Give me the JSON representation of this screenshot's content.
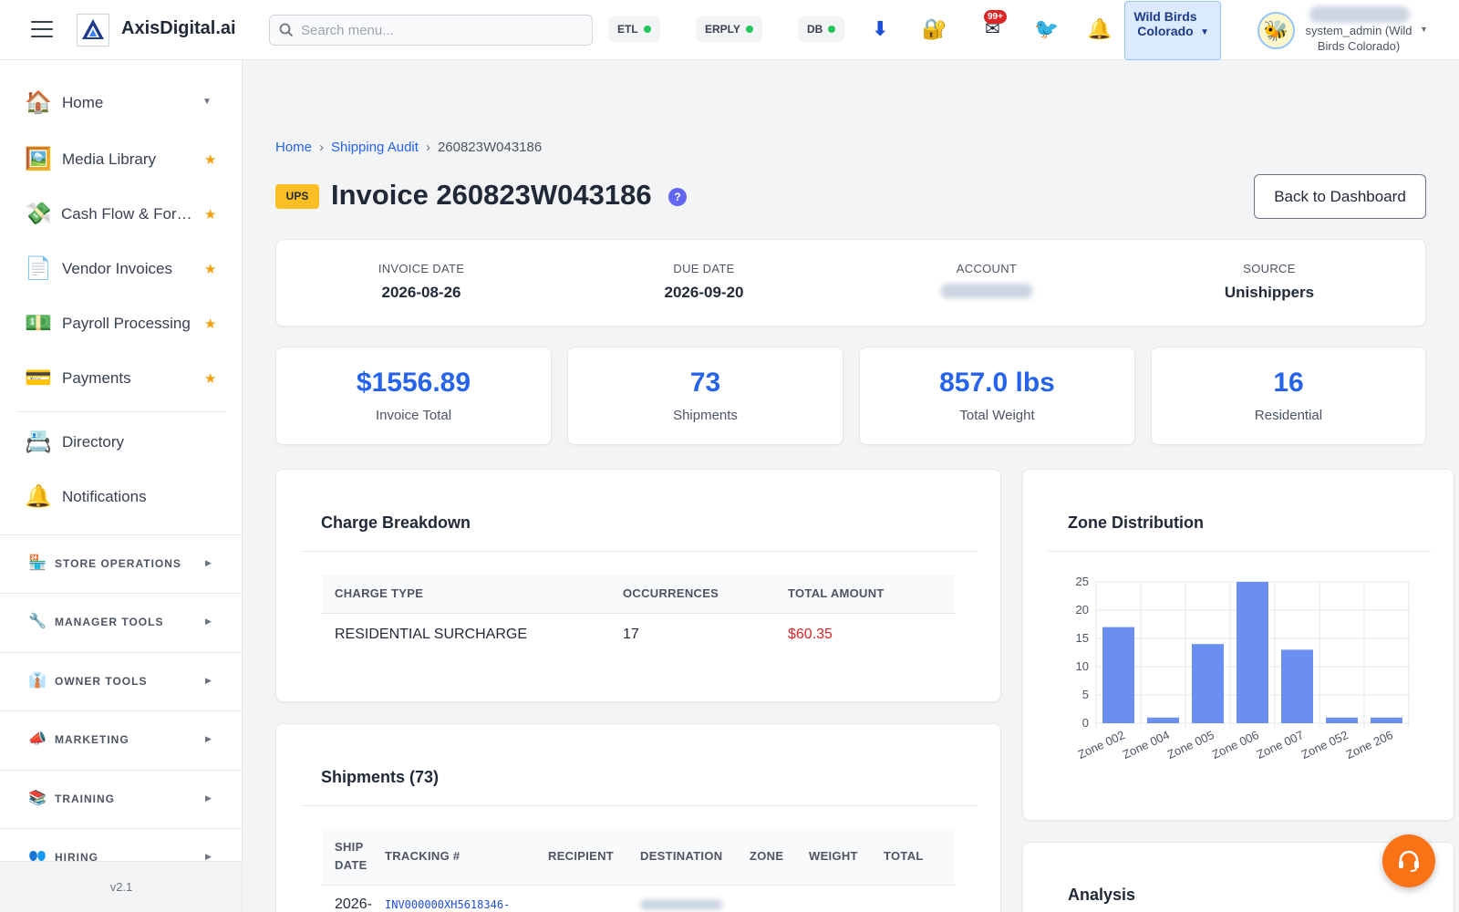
{
  "header": {
    "brand": "AxisDigital.ai",
    "search_placeholder": "Search menu...",
    "pills": [
      {
        "label": "ETL"
      },
      {
        "label": "ERPLY"
      },
      {
        "label": "DB"
      }
    ],
    "mail_badge": "99+",
    "store_label": "Wild Birds Colorado",
    "user_role": "system_admin (Wild Birds Colorado)"
  },
  "sidebar": {
    "items": [
      {
        "label": "Home",
        "icon": "house-icon"
      },
      {
        "label": "Media Library",
        "icon": "picture-icon"
      },
      {
        "label": "Cash Flow & Forecasting",
        "icon": "money-wings-icon"
      },
      {
        "label": "Vendor Invoices",
        "icon": "document-icon"
      },
      {
        "label": "Payroll Processing",
        "icon": "dollar-bill-icon"
      },
      {
        "label": "Payments",
        "icon": "credit-card-icon"
      },
      {
        "label": "Directory",
        "icon": "rolodex-icon"
      },
      {
        "label": "Notifications",
        "icon": "bell-icon"
      }
    ],
    "sections": [
      {
        "label": "STORE OPERATIONS",
        "icon": "store-icon"
      },
      {
        "label": "MANAGER TOOLS",
        "icon": "wrench-icon"
      },
      {
        "label": "OWNER TOOLS",
        "icon": "briefcase-person-icon"
      },
      {
        "label": "MARKETING",
        "icon": "megaphone-icon"
      },
      {
        "label": "TRAINING",
        "icon": "books-icon"
      },
      {
        "label": "HIRING",
        "icon": "people-icon"
      }
    ],
    "version": "v2.1"
  },
  "breadcrumb": {
    "home": "Home",
    "section": "Shipping Audit",
    "current": "260823W043186"
  },
  "invoice": {
    "carrier": "UPS",
    "title": "Invoice 260823W043186",
    "help": "?",
    "back_label": "Back to Dashboard",
    "info": {
      "invoice_date_label": "INVOICE DATE",
      "invoice_date": "2026-08-26",
      "due_date_label": "DUE DATE",
      "due_date": "2026-09-20",
      "account_label": "ACCOUNT",
      "source_label": "SOURCE",
      "source": "Unishippers"
    },
    "stats": [
      {
        "value": "$1556.89",
        "label": "Invoice Total"
      },
      {
        "value": "73",
        "label": "Shipments"
      },
      {
        "value": "857.0 lbs",
        "label": "Total Weight"
      },
      {
        "value": "16",
        "label": "Residential"
      }
    ]
  },
  "charges": {
    "title": "Charge Breakdown",
    "columns": [
      "CHARGE TYPE",
      "OCCURRENCES",
      "TOTAL AMOUNT"
    ],
    "rows": [
      {
        "type": "RESIDENTIAL SURCHARGE",
        "occurrences": "17",
        "amount": "$60.35"
      }
    ],
    "amount_color": "#dc2626"
  },
  "shipments": {
    "title": "Shipments (73)",
    "columns": [
      "SHIP DATE",
      "TRACKING #",
      "RECIPIENT",
      "DESTINATION",
      "ZONE",
      "WEIGHT",
      "TOTAL"
    ],
    "first_row": {
      "ship_date": "2026-",
      "tracking": "INV000000XH5618346-"
    }
  },
  "analysis": {
    "title": "Analysis"
  },
  "chart_data": {
    "type": "bar",
    "title": "Zone Distribution",
    "categories": [
      "Zone 002",
      "Zone 004",
      "Zone 005",
      "Zone 006",
      "Zone 007",
      "Zone 052",
      "Zone 206"
    ],
    "values": [
      17,
      1,
      14,
      25,
      13,
      1,
      1
    ],
    "ylim": [
      0,
      25
    ],
    "yticks": [
      "0",
      "5",
      "10",
      "15",
      "20",
      "25"
    ],
    "grid": true,
    "bar_color": "#6b8ff0",
    "xlabel": "",
    "ylabel": ""
  },
  "colors": {
    "accent": "#2563eb",
    "carrier_badge": "#fbbf24",
    "fab": "#f97316"
  }
}
